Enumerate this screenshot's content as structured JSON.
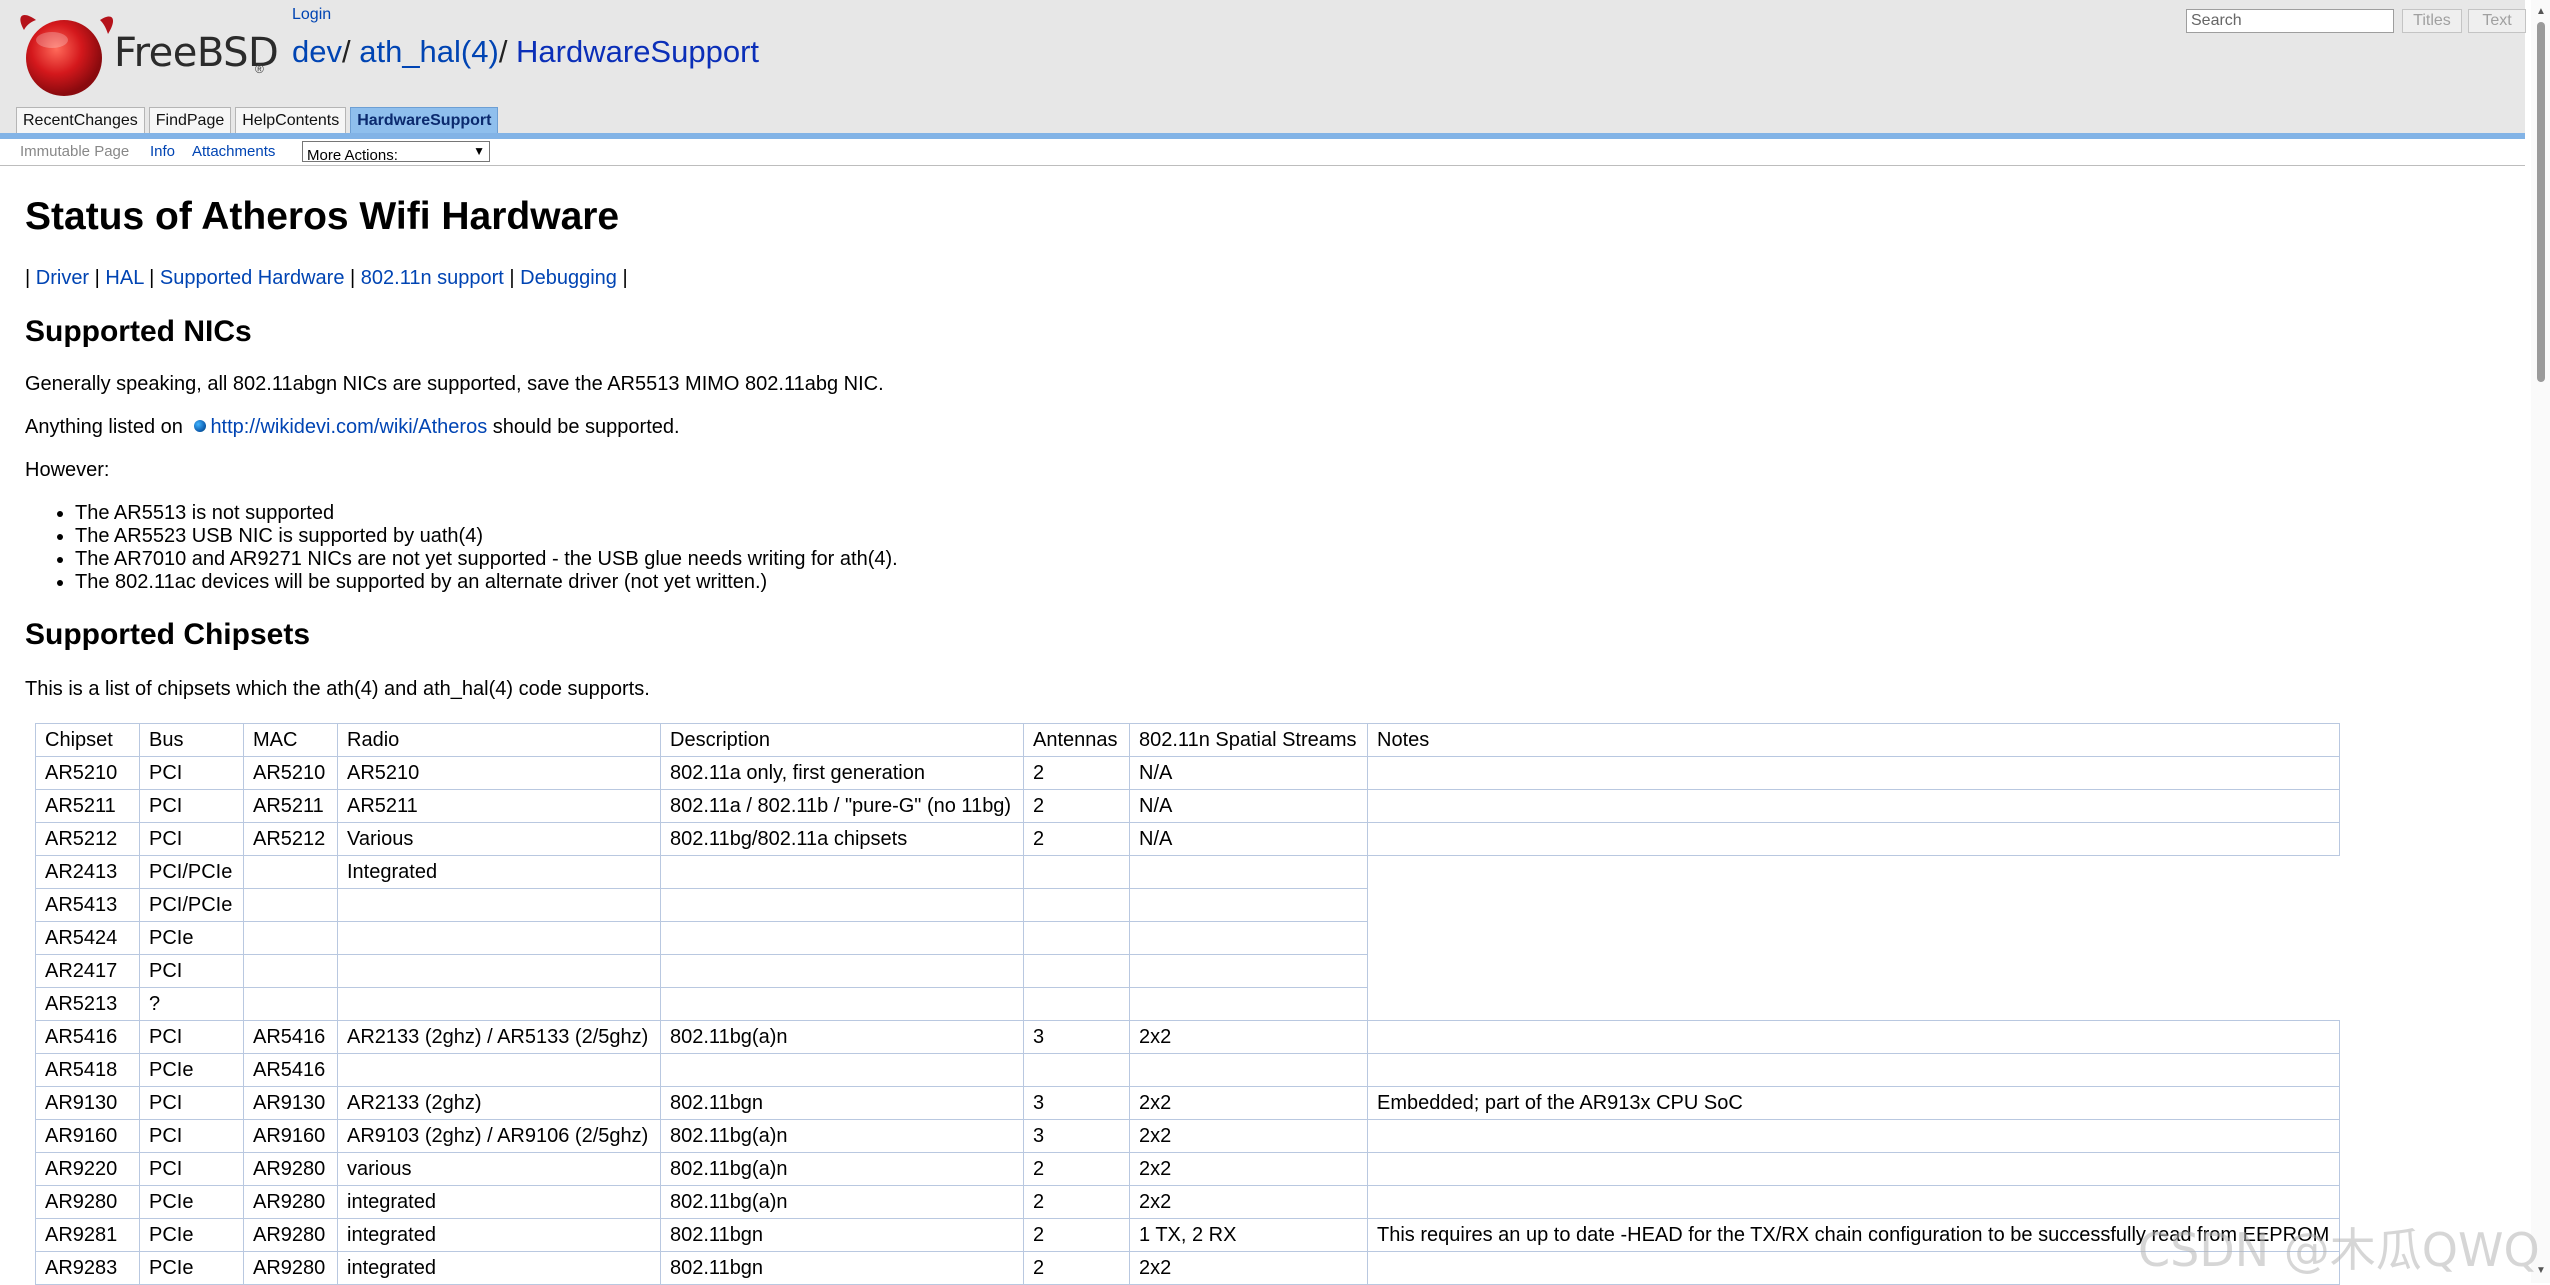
{
  "header": {
    "logo_text": "FreeBSD",
    "logo_mark": "®",
    "login": "Login",
    "breadcrumb": [
      {
        "label": "dev",
        "sep": "/ "
      },
      {
        "label": "ath_hal(4)",
        "sep": "/ "
      },
      {
        "label": "HardwareSupport",
        "sep": ""
      }
    ],
    "search_placeholder": "Search",
    "titles_button": "Titles",
    "text_button": "Text",
    "tabs": [
      {
        "label": "RecentChanges",
        "current": false
      },
      {
        "label": "FindPage",
        "current": false
      },
      {
        "label": "HelpContents",
        "current": false
      },
      {
        "label": "HardwareSupport",
        "current": true
      }
    ]
  },
  "actions": {
    "immutable": "Immutable Page",
    "info": "Info",
    "attachments": "Attachments",
    "more_actions": "More Actions:"
  },
  "content": {
    "title": "Status of Atheros Wifi Hardware",
    "toc": [
      "Driver",
      "HAL",
      "Supported Hardware",
      "802.11n support",
      "Debugging"
    ],
    "nics_heading": "Supported NICs",
    "nics_p1": "Generally speaking, all 802.11abgn NICs are supported, save the AR5513 MIMO 802.11abg NIC.",
    "nics_p2_before": "Anything listed on ",
    "nics_p2_link": "http://wikidevi.com/wiki/Atheros",
    "nics_p2_after": " should be supported.",
    "however": "However:",
    "bullets": [
      "The AR5513 is not supported",
      "The AR5523 USB NIC is supported by uath(4)",
      "The AR7010 and AR9271 NICs are not yet supported - the USB glue needs writing for ath(4).",
      "The 802.11ac devices will be supported by an alternate driver (not yet written.)"
    ],
    "chipsets_heading": "Supported Chipsets",
    "chipsets_intro": "This is a list of chipsets which the ath(4) and ath_hal(4) code supports.",
    "table": {
      "headers": [
        "Chipset",
        "Bus",
        "MAC",
        "Radio",
        "Description",
        "Antennas",
        "802.11n Spatial Streams",
        "Notes"
      ],
      "rows": [
        [
          "AR5210",
          "PCI",
          "AR5210",
          "AR5210",
          "802.11a only, first generation",
          "2",
          "N/A",
          ""
        ],
        [
          "AR5211",
          "PCI",
          "AR5211",
          "AR5211",
          "802.11a / 802.11b / \"pure-G\" (no 11bg)",
          "2",
          "N/A",
          ""
        ],
        [
          "AR5212",
          "PCI",
          "AR5212",
          "Various",
          "802.11bg/802.11a chipsets",
          "2",
          "N/A",
          ""
        ],
        [
          "AR2413",
          "PCI/PCIe",
          "",
          "Integrated",
          "",
          "",
          "",
          null
        ],
        [
          "AR5413",
          "PCI/PCIe",
          "",
          "",
          "",
          "",
          "",
          null
        ],
        [
          "AR5424",
          "PCIe",
          "",
          "",
          "",
          "",
          "",
          null
        ],
        [
          "AR2417",
          "PCI",
          "",
          "",
          "",
          "",
          "",
          null
        ],
        [
          "AR5213",
          "?",
          "",
          "",
          "",
          "",
          "",
          null
        ],
        [
          "AR5416",
          "PCI",
          "AR5416",
          "AR2133 (2ghz) / AR5133 (2/5ghz)",
          "802.11bg(a)n",
          "3",
          "2x2",
          ""
        ],
        [
          "AR5418",
          "PCIe",
          "AR5416",
          "",
          "",
          "",
          "",
          ""
        ],
        [
          "AR9130",
          "PCI",
          "AR9130",
          "AR2133 (2ghz)",
          "802.11bgn",
          "3",
          "2x2",
          "Embedded; part of the AR913x CPU SoC"
        ],
        [
          "AR9160",
          "PCI",
          "AR9160",
          "AR9103 (2ghz) / AR9106 (2/5ghz)",
          "802.11bg(a)n",
          "3",
          "2x2",
          ""
        ],
        [
          "AR9220",
          "PCI",
          "AR9280",
          "various",
          "802.11bg(a)n",
          "2",
          "2x2",
          ""
        ],
        [
          "AR9280",
          "PCIe",
          "AR9280",
          "integrated",
          "802.11bg(a)n",
          "2",
          "2x2",
          ""
        ],
        [
          "AR9281",
          "PCIe",
          "AR9280",
          "integrated",
          "802.11bgn",
          "2",
          "1 TX, 2 RX",
          "This requires an up to date -HEAD for the TX/RX chain configuration to be successfully read from EEPROM"
        ],
        [
          "AR9283",
          "PCIe",
          "AR9280",
          "integrated",
          "802.11bgn",
          "2",
          "2x2",
          ""
        ]
      ]
    }
  },
  "watermark": "CSDN @木瓜QWQ"
}
